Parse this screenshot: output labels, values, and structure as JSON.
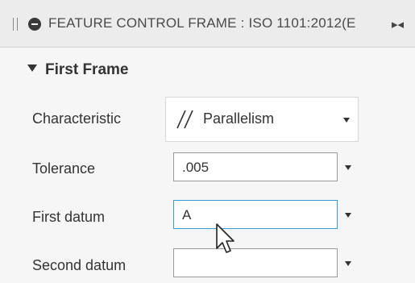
{
  "panel": {
    "title": "FEATURE CONTROL FRAME : ISO 1101:2012(E",
    "icons": {
      "grip": "grip-handle-icon",
      "close": "minus-circle-icon",
      "expand": "expand-arrows-icon"
    }
  },
  "section": {
    "title": "First Frame",
    "icon": "caret-down-icon"
  },
  "characteristic": {
    "label": "Characteristic",
    "value": "Parallelism",
    "icon": "parallelism-icon"
  },
  "tolerance": {
    "label": "Tolerance",
    "value": ".005"
  },
  "first_datum": {
    "label": "First datum",
    "value": "A"
  },
  "second_datum": {
    "label": "Second datum",
    "value": ""
  },
  "colors": {
    "focus_border": "#3a9ad9",
    "panel_bg": "#f6f6f6"
  }
}
